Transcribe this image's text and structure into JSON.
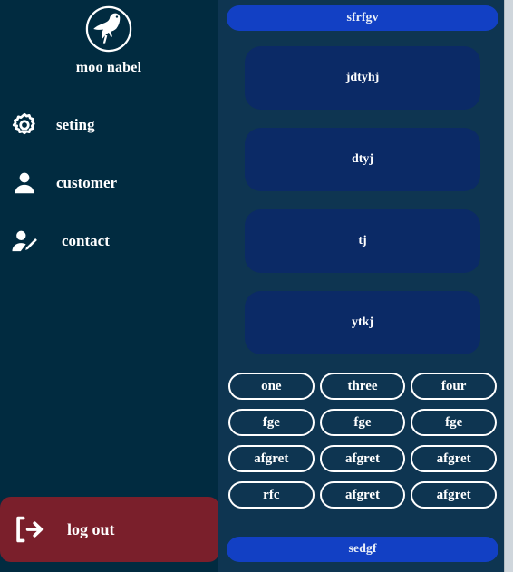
{
  "sidebar": {
    "logo_icon": "bird-logo-icon",
    "brand_name": "moo nabel",
    "items": [
      {
        "label": "seting",
        "icon": "gear-icon"
      },
      {
        "label": "customer",
        "icon": "user-icon"
      },
      {
        "label": "contact",
        "icon": "user-edit-icon"
      }
    ],
    "logout": {
      "label": "log out",
      "icon": "logout-arrow-icon",
      "color": "#7a1f2b"
    },
    "background_color": "#012b40"
  },
  "main": {
    "background_color": "#0e3551",
    "top_button": {
      "label": "sfrfgv",
      "color": "#1240c4"
    },
    "cards": [
      {
        "label": "jdtyhj"
      },
      {
        "label": "dtyj"
      },
      {
        "label": "tj"
      },
      {
        "label": "ytkj"
      }
    ],
    "card_color": "#0b2a66",
    "pills": [
      {
        "label": "one"
      },
      {
        "label": "three"
      },
      {
        "label": "four"
      },
      {
        "label": "fge"
      },
      {
        "label": "fge"
      },
      {
        "label": "fge"
      },
      {
        "label": "afgret"
      },
      {
        "label": "afgret"
      },
      {
        "label": "afgret"
      },
      {
        "label": "rfc"
      },
      {
        "label": "afgret"
      },
      {
        "label": "afgret"
      }
    ],
    "bottom_button": {
      "label": "sedgf",
      "color": "#1240c4"
    }
  }
}
